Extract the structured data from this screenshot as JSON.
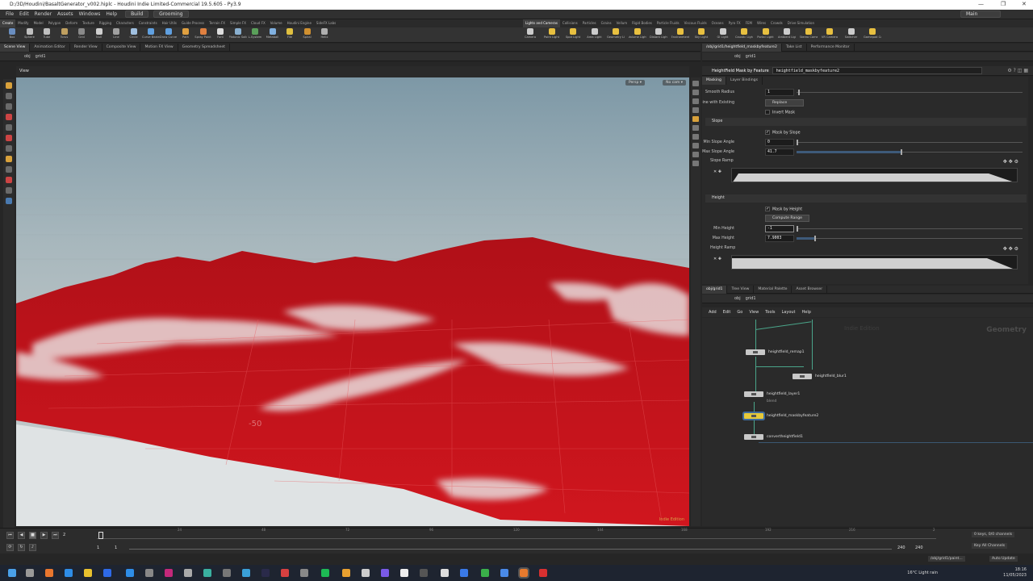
{
  "window": {
    "title": "D:/3D/Houdini/BasaltGenerator_v002.hiplc - Houdini Indie Limited-Commercial 19.5.605 - Py3.9",
    "controls": [
      "—",
      "❐",
      "✕"
    ]
  },
  "menubar": {
    "items": [
      "File",
      "Edit",
      "Render",
      "Assets",
      "Windows",
      "Help"
    ],
    "desktop_build": "Build",
    "desktop_grooming": "Grooming",
    "desktop_main": "Main"
  },
  "shelf": {
    "tabs_left": [
      "Create",
      "Modify",
      "Model",
      "Polygon",
      "Deform",
      "Texture",
      "Rigging",
      "Characters",
      "Constraints",
      "Hair Utils",
      "Guide Process",
      "Terrain FX",
      "Simple FX",
      "Cloud FX",
      "Volume",
      "Houdini Engine",
      "SideFX Labs"
    ],
    "tabs_right": [
      "Lights and Cameras",
      "Collisions",
      "Particles",
      "Grains",
      "Vellum",
      "Rigid Bodies",
      "Particle Fluids",
      "Viscous Fluids",
      "Oceans",
      "Pyro FX",
      "FEM",
      "Wires",
      "Crowds",
      "Drive Simulation"
    ],
    "tools_left": [
      "Box",
      "Sphere",
      "Tube",
      "Torus",
      "Grid",
      "Null",
      "Line",
      "Circle",
      "Curve Bezier",
      "Draw Curve",
      "Path",
      "Spray Paint",
      "Font",
      "Platonic Solids",
      "L-System",
      "Metaball",
      "File",
      "Spiral",
      "Helix"
    ],
    "tools_right": [
      "Camera",
      "Point Light",
      "Spot Light",
      "Area Light",
      "Geometry Light",
      "Volume Light",
      "Distant Light",
      "Environment Light",
      "Sky Light",
      "GI Light",
      "Caustic Light",
      "Portal Light",
      "Ambient Light",
      "Stereo Camera",
      "VR Camera",
      "Switcher",
      "Gamepad Camera"
    ]
  },
  "left_panetabs": [
    "Scene View",
    "Animation Editor",
    "Render View",
    "Composite View",
    "Motion FX View",
    "Geometry Spreadsheet"
  ],
  "right_panetabs": [
    "/obj/grid1/heightfield_maskbyfeature2",
    "Take List",
    "Performance Monitor"
  ],
  "viewport": {
    "path": [
      "obj",
      "grid1"
    ],
    "label": "View",
    "camera_menu": "Persp ▾",
    "cam_menu": "No cam ▾",
    "watermark": "Indie Edition",
    "grid_label": "-50"
  },
  "params": {
    "node_type": "HeightField Mask by Feature",
    "node_name": "heightfield_maskbyfeature2",
    "path": [
      "obj",
      "grid1"
    ],
    "tabs": [
      "Masking",
      "Layer Bindings"
    ],
    "smooth_radius_label": "Smooth Radius",
    "smooth_radius": "1",
    "combine_label": "Combine with Existing",
    "combine_value": "Replace",
    "invert_mask": "Invert Mask",
    "slope_section": "Slope",
    "mask_by_slope": "Mask by Slope",
    "min_slope_label": "Min Slope Angle",
    "min_slope": "0",
    "max_slope_label": "Max Slope Angle",
    "max_slope": "41.7",
    "slope_ramp_label": "Slope Ramp",
    "height_section": "Height",
    "mask_by_height": "Mask by Height",
    "compute_range": "Compute Range",
    "min_height_label": "Min Height",
    "min_height": "-1",
    "max_height_label": "Max Height",
    "max_height": "7.9003",
    "height_ramp_label": "Height Ramp"
  },
  "network": {
    "tabs": [
      "obj/grid1",
      "Tree View",
      "Material Palette",
      "Asset Browser"
    ],
    "path": [
      "obj",
      "grid1"
    ],
    "menu": [
      "Add",
      "Edit",
      "Go",
      "View",
      "Tools",
      "Layout",
      "Help"
    ],
    "context": "Geometry",
    "edition": "Indie Edition",
    "nodes": [
      {
        "name": "heightfield_remap1"
      },
      {
        "name": "heightfield_blur1"
      },
      {
        "name": "heightfield_layer1",
        "sub": "blend"
      },
      {
        "name": "heightfield_maskbyfeature2",
        "selected": true
      },
      {
        "name": "convertheightfield1"
      }
    ]
  },
  "timeline": {
    "current_frame": "2",
    "start": "1",
    "start2": "1",
    "end": "240",
    "end2": "240",
    "ticks": [
      "24",
      "48",
      "72",
      "96",
      "120",
      "144",
      "168",
      "192",
      "216",
      "2"
    ],
    "keys_info": "0 keys, 0/0 channels",
    "key_all": "Key All Channels",
    "auto_update": "Auto Update",
    "path_field": "/obj/grid1/paint..."
  },
  "taskbar": {
    "weather": "16°C  Light rain",
    "time": "18:16",
    "date": "11/05/2023"
  },
  "colors": {
    "accent": "#3d6a9c",
    "mask_red": "#c4141c",
    "node_selected": "#e6c93a",
    "wire": "#4aa58a"
  }
}
